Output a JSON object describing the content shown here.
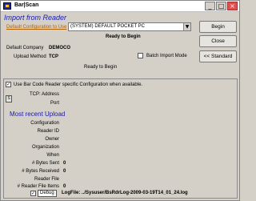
{
  "window": {
    "title": "Bar|Scan"
  },
  "header": {
    "heading": "Import from Reader"
  },
  "config": {
    "link_label": "Default Configuration to Use",
    "selected": "(SYSTEM) DEFAULT POCKET PC",
    "status": "Ready to Begin"
  },
  "info": {
    "company_label": "Default Company",
    "company_value": "DEMOCO",
    "upload_label": "Upload Method",
    "upload_value": "TCP",
    "batch_label": "Batch Import Mode",
    "status2": "Ready to Begin"
  },
  "buttons": {
    "begin": "Begin",
    "close": "Close",
    "standard": "<< Standard"
  },
  "panel": {
    "use_specific_label": "Use Bar Code Reader specific Configuration when available.",
    "small_box": "S",
    "tcp_address_label": "TCP: Address",
    "port_label": "Port",
    "recent_title": "Most recent Upload",
    "fields": [
      {
        "label": "Configuration",
        "value": ""
      },
      {
        "label": "Reader ID",
        "value": ""
      },
      {
        "label": "Owner",
        "value": ""
      },
      {
        "label": "Organization",
        "value": ""
      },
      {
        "label": "When",
        "value": ""
      },
      {
        "label": "# Bytes Sent",
        "value": "0"
      },
      {
        "label": "# Bytes Received",
        "value": "0"
      },
      {
        "label": "Reader File",
        "value": ""
      },
      {
        "label": "# Reader File Items",
        "value": "0"
      }
    ],
    "debug_label": "Debug",
    "logfile_text": "LogFile: ../Sysuser/BsRdrLog-2009-03-19T14_01_24.log"
  }
}
